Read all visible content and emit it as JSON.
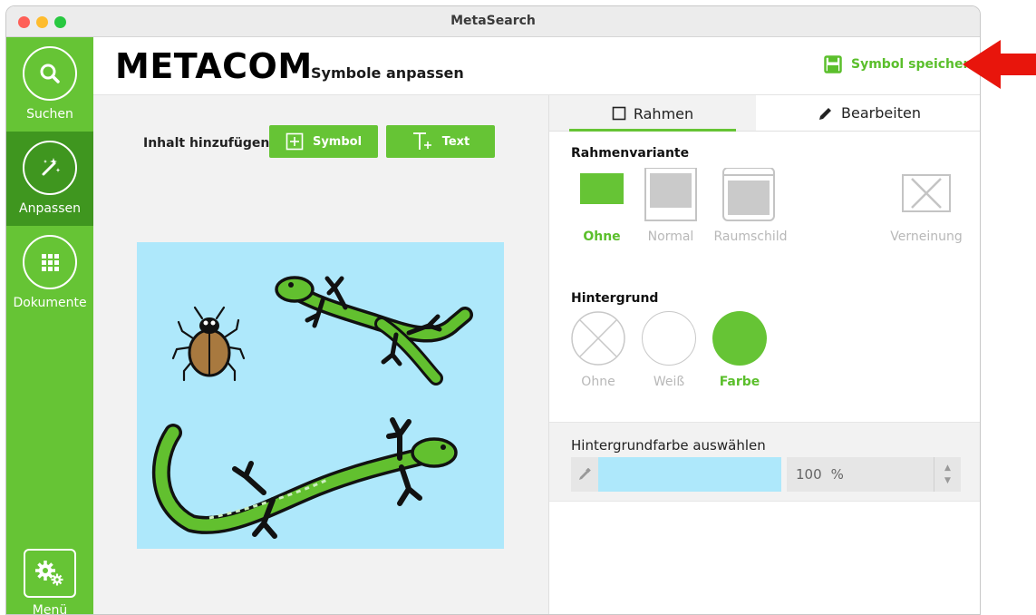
{
  "window": {
    "title": "MetaSearch"
  },
  "sidebar": {
    "items": [
      {
        "label": "Suchen",
        "icon": "search-icon"
      },
      {
        "label": "Anpassen",
        "icon": "magic-wand-icon"
      },
      {
        "label": "Dokumente",
        "icon": "grid-icon"
      }
    ],
    "menu_label": "Menü"
  },
  "header": {
    "brand": "METACOM",
    "subtitle": "Symbole anpassen",
    "save_label": "Symbol speichern"
  },
  "editor": {
    "add_label": "Inhalt hinzufügen:",
    "symbol_button": "Symbol",
    "text_button": "Text",
    "canvas_color": "#aee8fb"
  },
  "panel": {
    "tabs": [
      {
        "label": "Rahmen"
      },
      {
        "label": "Bearbeiten"
      }
    ],
    "frame_title": "Rahmenvariante",
    "frame_options": [
      "Ohne",
      "Normal",
      "Raumschild",
      "Verneinung"
    ],
    "background_title": "Hintergrund",
    "background_options": [
      "Ohne",
      "Weiß",
      "Farbe"
    ],
    "color_title": "Hintergrundfarbe auswählen",
    "opacity_value": "100",
    "opacity_unit": "%",
    "selected_color": "#aee8fb"
  },
  "colors": {
    "accent": "#66c435",
    "accent_dark": "#3f961f",
    "arrow": "#e8150c"
  }
}
